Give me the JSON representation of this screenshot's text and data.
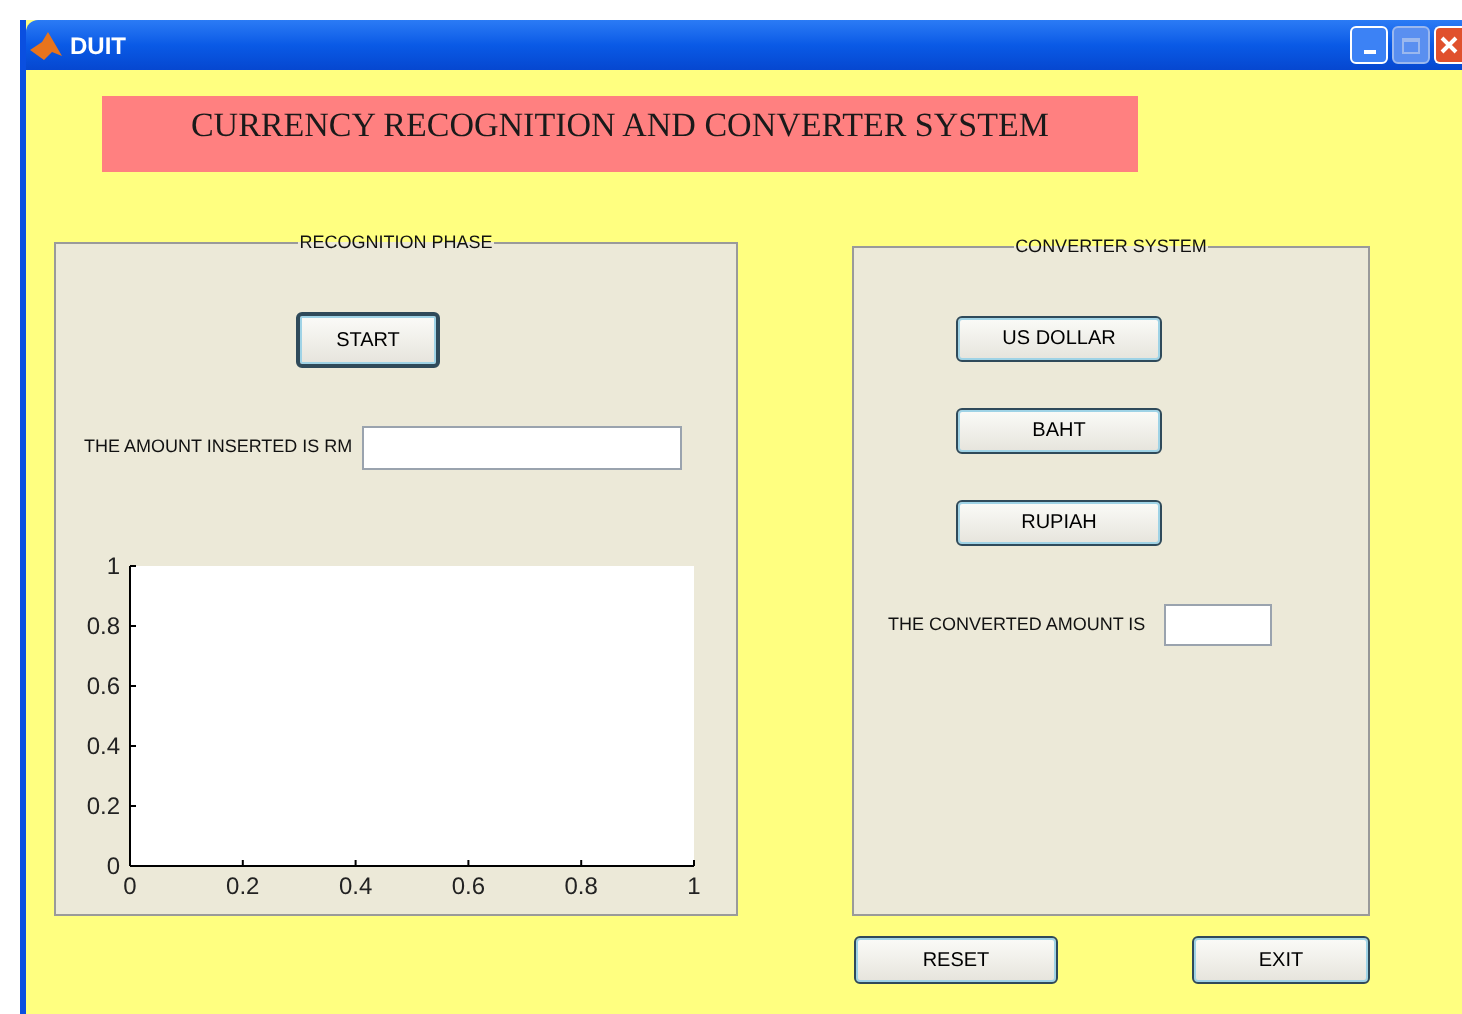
{
  "window": {
    "title": "DUIT"
  },
  "banner": "CURRENCY RECOGNITION AND CONVERTER SYSTEM",
  "recognition_panel": {
    "title": "RECOGNITION PHASE",
    "start_button": "START",
    "amount_label": "THE AMOUNT INSERTED IS RM",
    "chart_data": {
      "type": "line",
      "xlim": [
        0,
        1
      ],
      "ylim": [
        0,
        1
      ],
      "xticks": [
        0,
        0.2,
        0.4,
        0.6,
        0.8,
        1
      ],
      "yticks": [
        0,
        0.2,
        0.4,
        0.6,
        0.8,
        1
      ]
    }
  },
  "converter_panel": {
    "title": "CONVERTER SYSTEM",
    "currency_buttons": [
      "US DOLLAR",
      "BAHT",
      "RUPIAH"
    ],
    "converted_label": "THE CONVERTED AMOUNT IS"
  },
  "buttons": [
    "RESET",
    "EXIT"
  ]
}
